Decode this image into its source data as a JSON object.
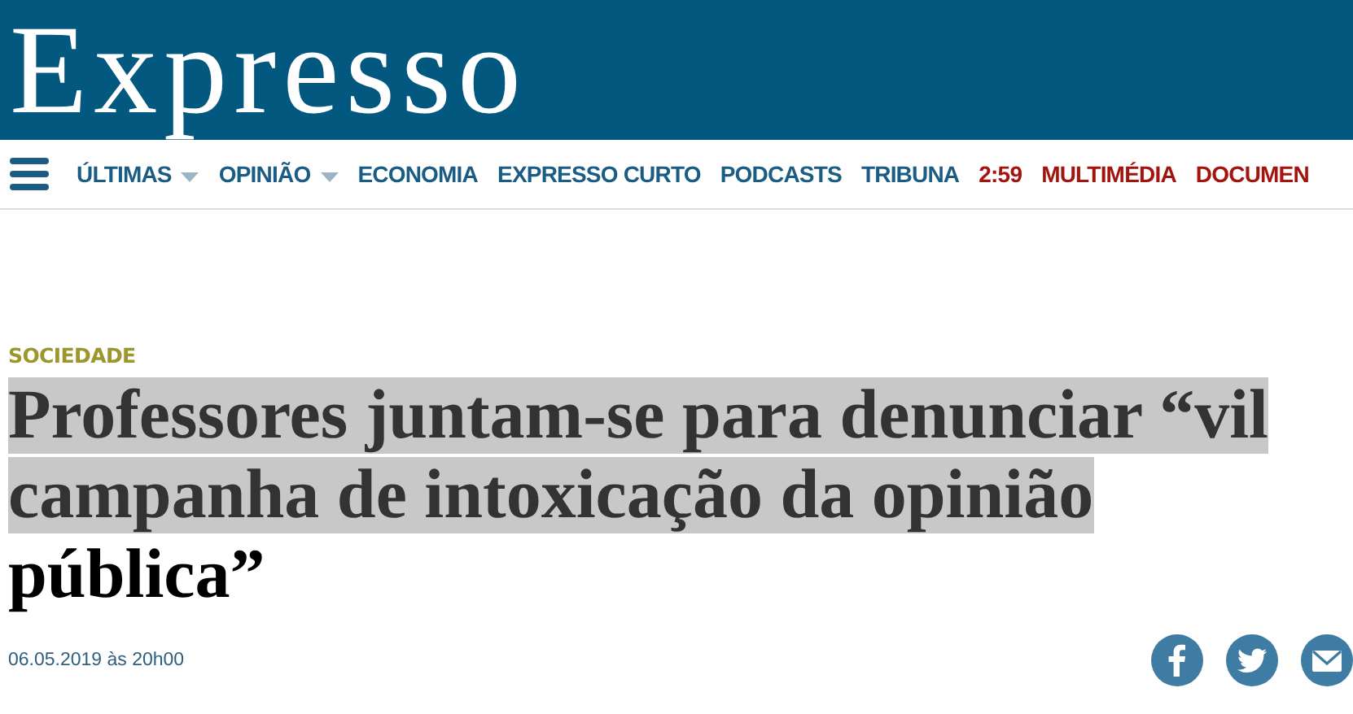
{
  "header": {
    "logo": "Expresso"
  },
  "nav": {
    "items": [
      {
        "label": "ÚLTIMAS",
        "dropdown": true,
        "color": "#1b5c84"
      },
      {
        "label": "OPINIÃO",
        "dropdown": true,
        "color": "#1b5c84"
      },
      {
        "label": "ECONOMIA",
        "dropdown": false,
        "color": "#1b5c84"
      },
      {
        "label": "EXPRESSO CURTO",
        "dropdown": false,
        "color": "#1b5c84"
      },
      {
        "label": "PODCASTS",
        "dropdown": false,
        "color": "#1b5c84"
      },
      {
        "label": "TRIBUNA",
        "dropdown": false,
        "color": "#1b5c84"
      },
      {
        "label": "2:59",
        "dropdown": false,
        "color": "#a3140f"
      },
      {
        "label": "MULTIMÉDIA",
        "dropdown": false,
        "color": "#a3140f"
      },
      {
        "label": "DOCUMEN",
        "dropdown": false,
        "color": "#a3140f"
      }
    ]
  },
  "article": {
    "category": "SOCIEDADE",
    "headline": [
      {
        "text": "Professores juntam-se para denunciar “vil campanha de intoxicação da opinião ",
        "highlighted": true
      },
      {
        "text": "pública”",
        "highlighted": false
      }
    ],
    "date": "06.05.2019 às 20h00",
    "share": [
      {
        "kind": "facebook"
      },
      {
        "kind": "twitter"
      },
      {
        "kind": "email"
      }
    ]
  }
}
